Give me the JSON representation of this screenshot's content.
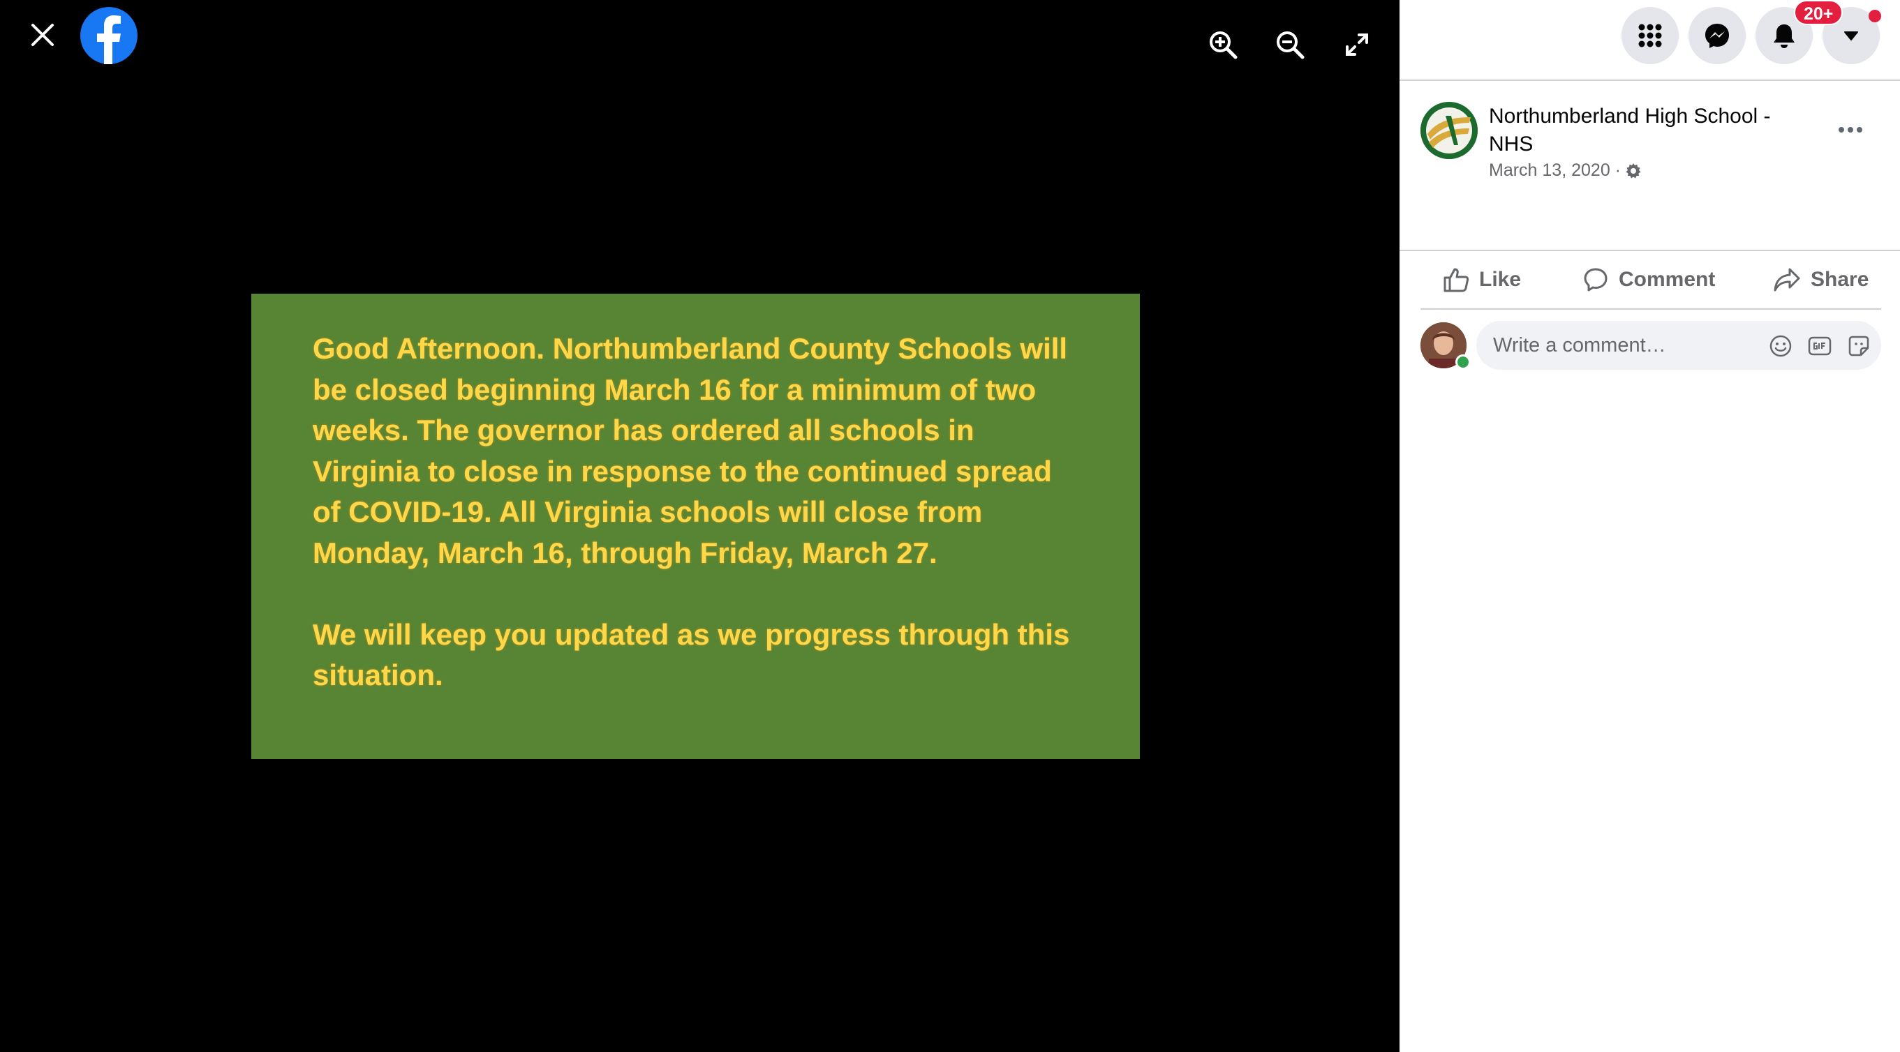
{
  "viewer": {
    "close_icon": "close-icon",
    "logo_icon": "facebook-logo",
    "controls": [
      "zoom-in-icon",
      "zoom-out-icon",
      "fullscreen-icon"
    ],
    "photo": {
      "background": "#578534",
      "text_color": "#ffd84a",
      "paragraph_1": "Good Afternoon. Northumberland County Schools will\nbe closed beginning March 16 for a minimum of two\nweeks. The governor has ordered all schools in\nVirginia to close in response to the continued spread\nof COVID-19.  All Virginia schools will close from\nMonday, March 16, through Friday, March 27.",
      "paragraph_2": "We will keep you updated as we progress through this\nsituation."
    }
  },
  "topbar": {
    "notifications_badge": "20+",
    "icons": [
      "menu-grid-icon",
      "messenger-icon",
      "bell-icon",
      "caret-down-icon"
    ]
  },
  "post": {
    "page_name": "Northumberland High School - NHS",
    "date": "March 13, 2020 ·",
    "privacy_icon": "gear-icon"
  },
  "actions": {
    "like": "Like",
    "comment": "Comment",
    "share": "Share"
  },
  "comment_box": {
    "placeholder": "Write a comment…",
    "icons": [
      "emoji-icon",
      "gif-icon",
      "sticker-icon"
    ]
  },
  "colors": {
    "brand": "#1877f2",
    "badge": "#e41e3f",
    "online": "#31a24c"
  }
}
